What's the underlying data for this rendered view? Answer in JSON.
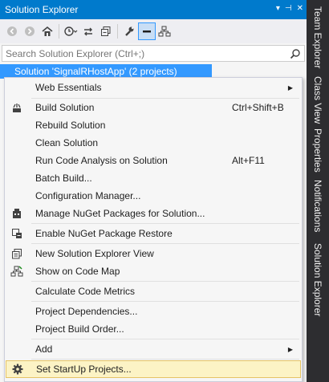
{
  "panel": {
    "title": "Solution Explorer",
    "title_controls": [
      "▾",
      "⊣",
      "✕"
    ],
    "search_placeholder": "Search Solution Explorer (Ctrl+;)",
    "tree_root": "Solution 'SignalRHostApp' (2 projects)"
  },
  "toolbar": {
    "icons": [
      "back-icon",
      "forward-icon",
      "home-icon",
      "history-icon",
      "sync-icon",
      "collapse-all-icon",
      "properties-wrench-icon",
      "pin-active-icon",
      "code-map-icon"
    ]
  },
  "dock_tabs": [
    "Team Explorer",
    "Class View",
    "Properties",
    "Notifications",
    "Solution Explorer"
  ],
  "menu": {
    "items": [
      {
        "label": "Web Essentials",
        "shortcut": "",
        "submenu": true,
        "icon": ""
      },
      {
        "label": "Build Solution",
        "shortcut": "Ctrl+Shift+B",
        "submenu": false,
        "icon": "build-icon"
      },
      {
        "label": "Rebuild Solution",
        "shortcut": "",
        "submenu": false,
        "icon": ""
      },
      {
        "label": "Clean Solution",
        "shortcut": "",
        "submenu": false,
        "icon": ""
      },
      {
        "label": "Run Code Analysis on Solution",
        "shortcut": "Alt+F11",
        "submenu": false,
        "icon": ""
      },
      {
        "label": "Batch Build...",
        "shortcut": "",
        "submenu": false,
        "icon": ""
      },
      {
        "label": "Configuration Manager...",
        "shortcut": "",
        "submenu": false,
        "icon": ""
      },
      {
        "label": "Manage NuGet Packages for Solution...",
        "shortcut": "",
        "submenu": false,
        "icon": "nuget-icon"
      },
      {
        "label": "Enable NuGet Package Restore",
        "shortcut": "",
        "submenu": false,
        "icon": "package-restore-icon"
      },
      {
        "label": "New Solution Explorer View",
        "shortcut": "",
        "submenu": false,
        "icon": "new-view-icon"
      },
      {
        "label": "Show on Code Map",
        "shortcut": "",
        "submenu": false,
        "icon": "code-map-icon"
      },
      {
        "label": "Calculate Code Metrics",
        "shortcut": "",
        "submenu": false,
        "icon": ""
      },
      {
        "label": "Project Dependencies...",
        "shortcut": "",
        "submenu": false,
        "icon": ""
      },
      {
        "label": "Project Build Order...",
        "shortcut": "",
        "submenu": false,
        "icon": ""
      },
      {
        "label": "Add",
        "shortcut": "",
        "submenu": true,
        "icon": ""
      },
      {
        "label": "Set StartUp Projects...",
        "shortcut": "",
        "submenu": false,
        "icon": "gear-icon",
        "highlighted": true
      }
    ]
  },
  "colors": {
    "accent": "#007acc",
    "selection": "#3399ff",
    "highlight": "#fcf3c5",
    "dock": "#2d2d30"
  }
}
